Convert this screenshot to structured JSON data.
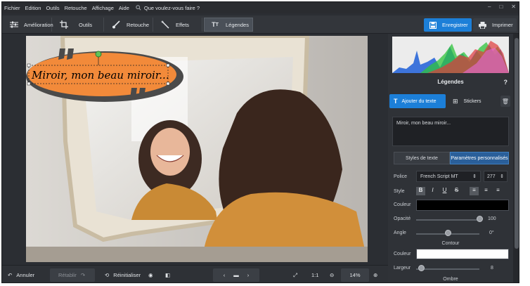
{
  "menu": [
    "Fichier",
    "Edition",
    "Outils",
    "Retouche",
    "Affichage",
    "Aide"
  ],
  "search_placeholder": "Que voulez-vous faire ?",
  "window_controls": {
    "minimize": "–",
    "maximize": "□",
    "close": "✕"
  },
  "tabs": [
    {
      "label": "Amélioration",
      "icon": "sliders-icon"
    },
    {
      "label": "Outils",
      "icon": "crop-icon"
    },
    {
      "label": "Retouche",
      "icon": "brush-icon"
    },
    {
      "label": "Effets",
      "icon": "magic-wand-icon"
    },
    {
      "label": "Légendes",
      "icon": "text-icon",
      "active": true
    }
  ],
  "actions": {
    "save": "Enregistrer",
    "print": "Imprimer"
  },
  "caption": {
    "text": "Miroir, mon beau miroir...",
    "bubble_color": "#f28a3a"
  },
  "bottom": {
    "undo": "Annuler",
    "redo": "Rétablir",
    "reset": "Réinitialiser",
    "ratio": "1:1",
    "zoom": "14%"
  },
  "panel": {
    "title": "Légendes",
    "help": "?",
    "add_text": "Ajouter du texte",
    "stickers": "Stickers",
    "text_value": "Miroir, mon beau miroir...",
    "subtabs": [
      "Styles de texte",
      "Paramètres personnalisés"
    ],
    "font_label": "Police",
    "font_value": "French Script MT",
    "font_size": "277",
    "style_label": "Style",
    "style_buttons": [
      "B",
      "I",
      "U",
      "S"
    ],
    "color_label": "Couleur",
    "text_color": "#000000",
    "opacity_label": "Opacité",
    "opacity_value": "100",
    "opacity_fraction": 1.0,
    "angle_label": "Angle",
    "angle_value": "0°",
    "angle_fraction": 0.5,
    "contour_label": "Contour",
    "contour_color_label": "Couleur",
    "contour_color": "#ffffff",
    "width_label": "Largeur",
    "width_value": "8",
    "width_fraction": 0.08,
    "shadow_label": "Ombre"
  },
  "accent": "#1c7fd8"
}
